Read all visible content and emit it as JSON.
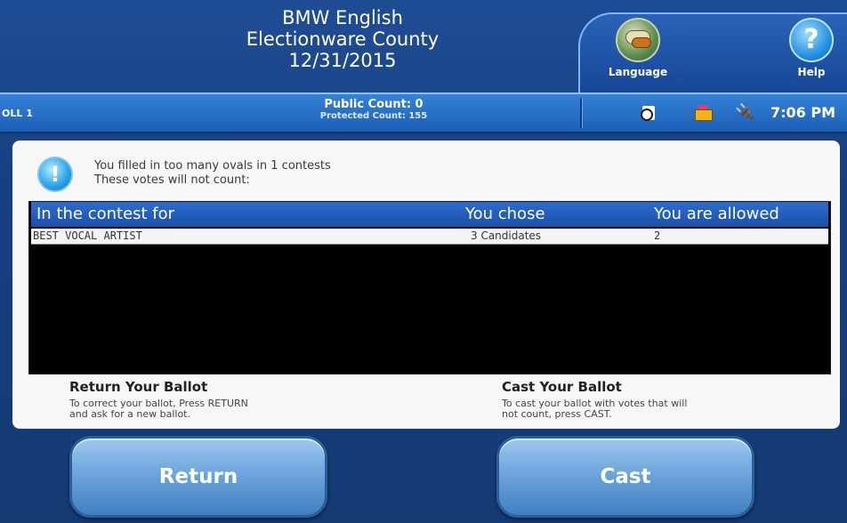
{
  "header": {
    "title_lines": [
      "BMW English",
      "Electionware County",
      "12/31/2015"
    ],
    "language_label": "Language",
    "help_label": "Help",
    "language_icon": "speech-bubbles-icon",
    "help_icon": "question-icon",
    "help_glyph": "?"
  },
  "status": {
    "poll": "OLL 1",
    "public_count": "Public Count: 0",
    "protected_count": "Protected Count: 155",
    "time": "7:06 PM",
    "icons": [
      "ballot-icon",
      "printer-icon",
      "power-plug-icon"
    ],
    "plug_glyph": "🔌"
  },
  "notice": {
    "icon_glyph": "!",
    "line1": "You filled in too many ovals in 1 contests",
    "line2": "These votes will not count:"
  },
  "table": {
    "headers": [
      "In the contest for",
      "You chose",
      "You are allowed"
    ],
    "rows": [
      [
        "BEST VOCAL ARTIST",
        "3 Candidates",
        "2"
      ]
    ]
  },
  "return_section": {
    "title": "Return Your Ballot",
    "desc_line1": "To correct your ballot, Press RETURN",
    "desc_line2": "and ask for a new ballot."
  },
  "cast_section": {
    "title": "Cast Your Ballot",
    "desc_line1": "To cast your ballot with votes that will",
    "desc_line2": "not count, press CAST."
  },
  "buttons": {
    "return_label": "Return",
    "cast_label": "Cast"
  },
  "colors": {
    "background": "#174080",
    "status_bar": "#2a72c8",
    "table_header": "#2460c0",
    "button": "#6ea6dc"
  }
}
